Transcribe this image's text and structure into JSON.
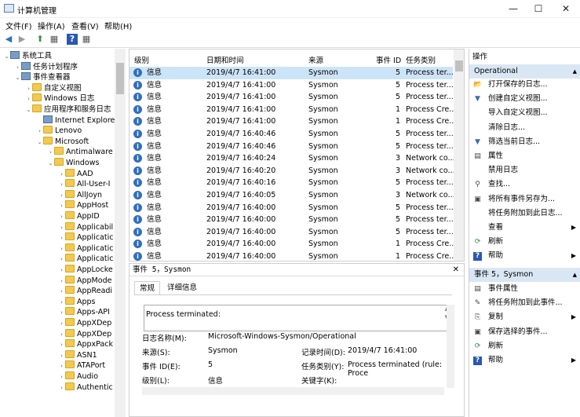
{
  "window": {
    "title": "计算机管理",
    "minimize": "—",
    "maximize": "☐",
    "close": "✕"
  },
  "menu": [
    "文件(F)",
    "操作(A)",
    "查看(V)",
    "帮助(H)"
  ],
  "toolbar": {
    "back": "◀",
    "forward": "▶",
    "up": "⬆",
    "pane": "▦",
    "help": "?",
    "view": "▦"
  },
  "tree": [
    {
      "label": "系统工具",
      "level": 1,
      "expander": "⌄",
      "icon": "tools-icon"
    },
    {
      "label": "任务计划程序",
      "level": 2,
      "expander": "›",
      "icon": "clock-icon"
    },
    {
      "label": "事件查看器",
      "level": 2,
      "expander": "⌄",
      "icon": "event-viewer-icon"
    },
    {
      "label": "自定义视图",
      "level": 3,
      "expander": "›",
      "icon": "folder-icon"
    },
    {
      "label": "Windows 日志",
      "level": 3,
      "expander": "›",
      "icon": "folder-icon"
    },
    {
      "label": "应用程序和服务日志",
      "level": 3,
      "expander": "⌄",
      "icon": "folder-icon"
    },
    {
      "label": "Internet Explorer",
      "level": 4,
      "expander": "",
      "icon": "log-icon"
    },
    {
      "label": "Lenovo",
      "level": 4,
      "expander": "›",
      "icon": "folder-icon"
    },
    {
      "label": "Microsoft",
      "level": 4,
      "expander": "⌄",
      "icon": "folder-icon"
    },
    {
      "label": "Antimalware",
      "level": 5,
      "expander": "›",
      "icon": "folder-icon"
    },
    {
      "label": "Windows",
      "level": 5,
      "expander": "⌄",
      "icon": "folder-icon"
    },
    {
      "label": "AAD",
      "level": 6,
      "expander": "›",
      "icon": "folder-icon"
    },
    {
      "label": "All-User-I",
      "level": 6,
      "expander": "›",
      "icon": "folder-icon"
    },
    {
      "label": "AllJoyn",
      "level": 6,
      "expander": "›",
      "icon": "folder-icon"
    },
    {
      "label": "AppHost",
      "level": 6,
      "expander": "›",
      "icon": "folder-icon"
    },
    {
      "label": "AppID",
      "level": 6,
      "expander": "›",
      "icon": "folder-icon"
    },
    {
      "label": "Applicabil",
      "level": 6,
      "expander": "›",
      "icon": "folder-icon"
    },
    {
      "label": "Applicatic",
      "level": 6,
      "expander": "›",
      "icon": "folder-icon"
    },
    {
      "label": "Applicatic",
      "level": 6,
      "expander": "›",
      "icon": "folder-icon"
    },
    {
      "label": "Applicatic",
      "level": 6,
      "expander": "›",
      "icon": "folder-icon"
    },
    {
      "label": "AppLocke",
      "level": 6,
      "expander": "›",
      "icon": "folder-icon"
    },
    {
      "label": "AppMode",
      "level": 6,
      "expander": "›",
      "icon": "folder-icon"
    },
    {
      "label": "AppReadi",
      "level": 6,
      "expander": "›",
      "icon": "folder-icon"
    },
    {
      "label": "Apps",
      "level": 6,
      "expander": "›",
      "icon": "folder-icon"
    },
    {
      "label": "Apps-API",
      "level": 6,
      "expander": "›",
      "icon": "folder-icon"
    },
    {
      "label": "AppXDep",
      "level": 6,
      "expander": "›",
      "icon": "folder-icon"
    },
    {
      "label": "AppXDep",
      "level": 6,
      "expander": "›",
      "icon": "folder-icon"
    },
    {
      "label": "AppxPack",
      "level": 6,
      "expander": "›",
      "icon": "folder-icon"
    },
    {
      "label": "ASN1",
      "level": 6,
      "expander": "›",
      "icon": "folder-icon"
    },
    {
      "label": "ATAPort",
      "level": 6,
      "expander": "›",
      "icon": "folder-icon"
    },
    {
      "label": "Audio",
      "level": 6,
      "expander": "›",
      "icon": "folder-icon"
    },
    {
      "label": "Authentic",
      "level": 6,
      "expander": "›",
      "icon": "folder-icon"
    }
  ],
  "list": {
    "columns": [
      "级别",
      "日期和时间",
      "来源",
      "事件 ID",
      "任务类别"
    ],
    "rows": [
      [
        "信息",
        "2019/4/7 16:41:00",
        "Sysmon",
        "5",
        "Process ter..."
      ],
      [
        "信息",
        "2019/4/7 16:41:00",
        "Sysmon",
        "5",
        "Process ter..."
      ],
      [
        "信息",
        "2019/4/7 16:41:00",
        "Sysmon",
        "5",
        "Process ter..."
      ],
      [
        "信息",
        "2019/4/7 16:41:00",
        "Sysmon",
        "1",
        "Process Cre..."
      ],
      [
        "信息",
        "2019/4/7 16:41:00",
        "Sysmon",
        "1",
        "Process Cre..."
      ],
      [
        "信息",
        "2019/4/7 16:40:46",
        "Sysmon",
        "5",
        "Process ter..."
      ],
      [
        "信息",
        "2019/4/7 16:40:46",
        "Sysmon",
        "5",
        "Process ter..."
      ],
      [
        "信息",
        "2019/4/7 16:40:24",
        "Sysmon",
        "3",
        "Network co..."
      ],
      [
        "信息",
        "2019/4/7 16:40:20",
        "Sysmon",
        "3",
        "Network co..."
      ],
      [
        "信息",
        "2019/4/7 16:40:16",
        "Sysmon",
        "5",
        "Process ter..."
      ],
      [
        "信息",
        "2019/4/7 16:40:05",
        "Sysmon",
        "3",
        "Network co..."
      ],
      [
        "信息",
        "2019/4/7 16:40:00",
        "Sysmon",
        "5",
        "Process ter..."
      ],
      [
        "信息",
        "2019/4/7 16:40:00",
        "Sysmon",
        "5",
        "Process ter..."
      ],
      [
        "信息",
        "2019/4/7 16:40:00",
        "Sysmon",
        "5",
        "Process ter..."
      ],
      [
        "信息",
        "2019/4/7 16:40:00",
        "Sysmon",
        "1",
        "Process Cre..."
      ],
      [
        "信息",
        "2019/4/7 16:40:00",
        "Sysmon",
        "1",
        "Process Cre..."
      ]
    ]
  },
  "detail": {
    "header": "事件 5，Sysmon",
    "close": "✕",
    "tabs": [
      "常规",
      "详细信息"
    ],
    "message": "Process terminated:",
    "log_name_label": "日志名称(M):",
    "log_name": "Microsoft-Windows-Sysmon/Operational",
    "source_label": "来源(S):",
    "source": "Sysmon",
    "logged_label": "记录时间(D):",
    "logged": "2019/4/7 16:41:00",
    "event_id_label": "事件 ID(E):",
    "event_id": "5",
    "task_label": "任务类别(Y):",
    "task": "Process terminated (rule: Proce",
    "level_label": "级别(L):",
    "level": "信息",
    "keywords_label": "关键字(K):"
  },
  "actions": {
    "header": "操作",
    "section1": "Operational",
    "section1_items": [
      {
        "label": "打开保存的日志...",
        "icon": "open-folder-icon",
        "glyph": "📂",
        "submenu": false
      },
      {
        "label": "创建自定义视图...",
        "icon": "filter-icon",
        "glyph": "▼",
        "submenu": false
      },
      {
        "label": "导入自定义视图...",
        "icon": "",
        "glyph": "",
        "submenu": false
      },
      {
        "label": "清除日志...",
        "icon": "",
        "glyph": "",
        "submenu": false
      },
      {
        "label": "筛选当前日志...",
        "icon": "filter-icon",
        "glyph": "▼",
        "submenu": false
      },
      {
        "label": "属性",
        "icon": "properties-icon",
        "glyph": "▤",
        "submenu": false
      },
      {
        "label": "禁用日志",
        "icon": "",
        "glyph": "",
        "submenu": false
      },
      {
        "label": "查找...",
        "icon": "binoculars-icon",
        "glyph": "⚲",
        "submenu": false
      },
      {
        "label": "将所有事件另存为...",
        "icon": "save-icon",
        "glyph": "▣",
        "submenu": false
      },
      {
        "label": "将任务附加到此日志...",
        "icon": "",
        "glyph": "",
        "submenu": false
      },
      {
        "label": "查看",
        "icon": "",
        "glyph": "",
        "submenu": true
      },
      {
        "label": "刷新",
        "icon": "refresh-icon",
        "glyph": "⟳",
        "submenu": false
      },
      {
        "label": "帮助",
        "icon": "help-icon",
        "glyph": "?",
        "submenu": true
      }
    ],
    "section2": "事件 5，Sysmon",
    "section2_items": [
      {
        "label": "事件属性",
        "icon": "properties-icon",
        "glyph": "▤",
        "submenu": false
      },
      {
        "label": "将任务附加到此事件...",
        "icon": "task-icon",
        "glyph": "✎",
        "submenu": false
      },
      {
        "label": "复制",
        "icon": "copy-icon",
        "glyph": "⎘",
        "submenu": true
      },
      {
        "label": "保存选择的事件...",
        "icon": "save-icon",
        "glyph": "▣",
        "submenu": false
      },
      {
        "label": "刷新",
        "icon": "refresh-icon",
        "glyph": "⟳",
        "submenu": false
      },
      {
        "label": "帮助",
        "icon": "help-icon",
        "glyph": "?",
        "submenu": true
      }
    ],
    "collapse": "▲",
    "submenu_arrow": "▶"
  },
  "colors": {
    "accent": "#d9e7f5",
    "selected_row": "#cce4f7",
    "info_icon": "#2f6fbf"
  }
}
